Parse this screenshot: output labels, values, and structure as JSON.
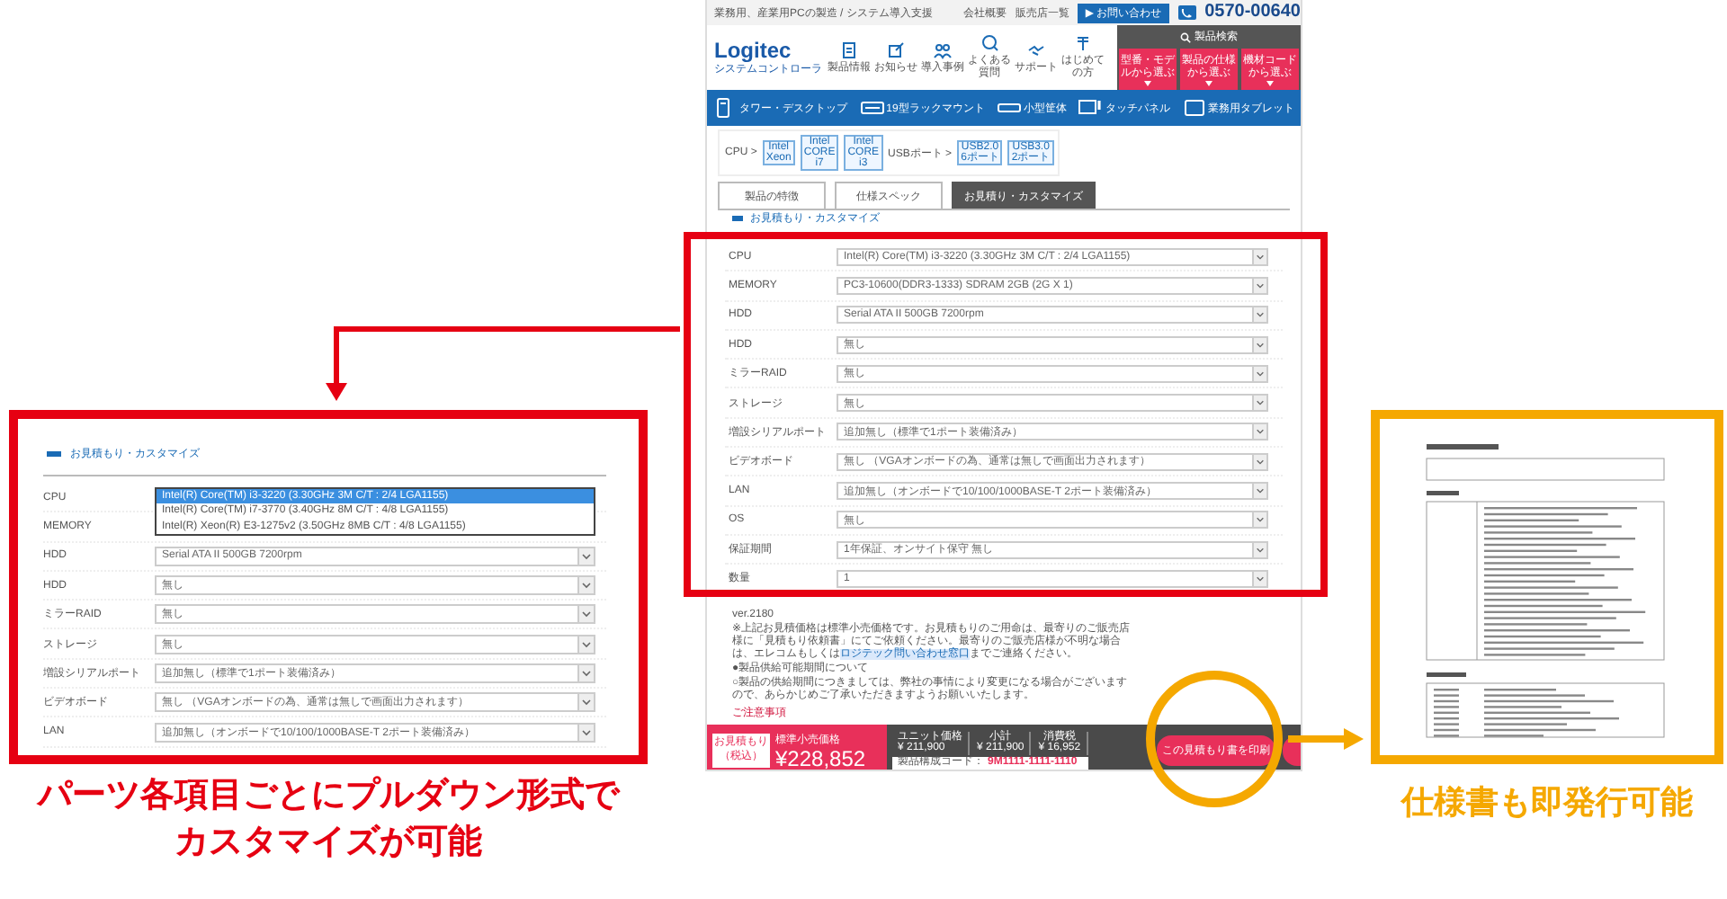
{
  "center_screenshot": {
    "top_bar": {
      "breadcrumb": "業務用、産業用PCの製造 / システム導入支援",
      "links": [
        "会社概要",
        "販売店一覧"
      ],
      "contact_button": "▶ お問い合わせ",
      "phone": "0570-00640"
    },
    "header": {
      "logo": "Logitec",
      "logo_sub": "システムコントローラ",
      "nav": [
        "製品情報",
        "お知らせ",
        "導入事例",
        "よくある質問",
        "サポート",
        "はじめての方"
      ],
      "search": {
        "title": "製品検索",
        "buttons": [
          "型番・モデルから選ぶ",
          "製品の仕様から選ぶ",
          "機材コードから選ぶ"
        ]
      }
    },
    "category_bar": [
      "タワー・デスクトップ",
      "19型ラックマウント",
      "小型筐体",
      "タッチパネル",
      "業務用タブレット"
    ],
    "spec_filter": [
      {
        "label": "CPU >",
        "chips": [
          [
            "Intel",
            "Xeon"
          ],
          [
            "Intel",
            "CORE",
            "i7"
          ],
          [
            "Intel",
            "CORE",
            "i3"
          ]
        ]
      },
      {
        "label": "USBポート >",
        "chips": [
          [
            "USB2.0",
            "6ポート"
          ],
          [
            "USB3.0",
            "2ポート"
          ]
        ]
      }
    ],
    "tabs": [
      {
        "label": "製品の特徴",
        "selected": false
      },
      {
        "label": "仕様スペック",
        "selected": false
      },
      {
        "label": "お見積り・カスタマイズ",
        "selected": true
      }
    ],
    "section_title": "お見積もり・カスタマイズ",
    "form_rows": [
      {
        "label": "CPU",
        "value": "Intel(R) Core(TM) i3-3220 (3.30GHz 3M C/T : 2/4 LGA1155)"
      },
      {
        "label": "MEMORY",
        "value": "PC3-10600(DDR3-1333) SDRAM 2GB (2G X 1)"
      },
      {
        "label": "HDD",
        "value": "Serial ATA II 500GB 7200rpm"
      },
      {
        "label": "HDD",
        "value": "無し"
      },
      {
        "label": "ミラーRAID",
        "value": "無し"
      },
      {
        "label": "ストレージ",
        "value": "無し"
      },
      {
        "label": "増設シリアルポート",
        "value": "追加無し（標準で1ポート装備済み）"
      },
      {
        "label": "ビデオボード",
        "value": "無し （VGAオンボードの為、通常は無しで画面出力されます）"
      },
      {
        "label": "LAN",
        "value": "追加無し（オンボードで10/100/1000BASE-T 2ポート装備済み）"
      },
      {
        "label": "OS",
        "value": "無し"
      },
      {
        "label": "保証期間",
        "value": "1年保証、オンサイト保守 無し"
      },
      {
        "label": "数量",
        "value": "1"
      }
    ],
    "notes": {
      "version": "ver.2180",
      "paragraph": "※上記お見積価格は標準小売価格です。お見積もりのご用命は、最寄りのご販売店様に「見積もり依頼書」にてご依頼ください。最寄りのご販売店様が不明な場合は、エレコムもしくは",
      "link": "ロジテック問い合わせ窓口",
      "paragraph_end": "までご連絡ください。",
      "supply_title": "●製品供給可能期間について",
      "supply_text": "○製品の供給期間につきましては、弊社の事情により変更になる場合がございますので、あらかじめご了承いただきますようお願いいたします。",
      "caution_link": "ご注意事項"
    },
    "price_bar": {
      "estimate_label": "お見積もり（税込）",
      "price_label": "標準小売価格",
      "price": "¥228,852",
      "figures": [
        {
          "label": "ユニット価格",
          "value": "¥ 211,900"
        },
        {
          "label": "小計",
          "value": "¥ 211,900"
        },
        {
          "label": "消費税",
          "value": "¥ 16,952"
        }
      ],
      "code_label": "製品構成コード：",
      "code": "9M1111-1111-1110",
      "print_button": "この見積もり書を印刷"
    }
  },
  "zoom_panel": {
    "section_title": "お見積もり・カスタマイズ",
    "rows": [
      {
        "label": "CPU",
        "expanded": true,
        "options": [
          {
            "text": "Intel(R) Core(TM) i3-3220 (3.30GHz 3M C/T : 2/4 LGA1155)",
            "selected": true
          },
          {
            "text": "Intel(R) Core(TM) i7-3770 (3.40GHz 8M C/T : 4/8 LGA1155)",
            "selected": false
          },
          {
            "text": "Intel(R) Xeon(R) E3-1275v2 (3.50GHz 8MB C/T : 4/8 LGA1155)",
            "selected": false
          }
        ]
      },
      {
        "label": "MEMORY",
        "expanded": false
      },
      {
        "label": "HDD",
        "value": "Serial ATA II 500GB 7200rpm",
        "expanded": false
      },
      {
        "label": "HDD",
        "value": "無し",
        "expanded": false
      },
      {
        "label": "ミラーRAID",
        "value": "無し",
        "expanded": false
      },
      {
        "label": "ストレージ",
        "value": "無し",
        "expanded": false
      },
      {
        "label": "増設シリアルポート",
        "value": "追加無し（標準で1ポート装備済み）",
        "expanded": false
      },
      {
        "label": "ビデオボード",
        "value": "無し （VGAオンボードの為、通常は無しで画面出力されます）",
        "expanded": false
      },
      {
        "label": "LAN",
        "value": "追加無し（オンボードで10/100/1000BASE-T 2ポート装備済み）",
        "expanded": false
      }
    ]
  },
  "captions": {
    "left": [
      "パーツ各項目ごとにプルダウン形式で",
      "カスタマイズが可能"
    ],
    "right": "仕様書も即発行可能"
  }
}
